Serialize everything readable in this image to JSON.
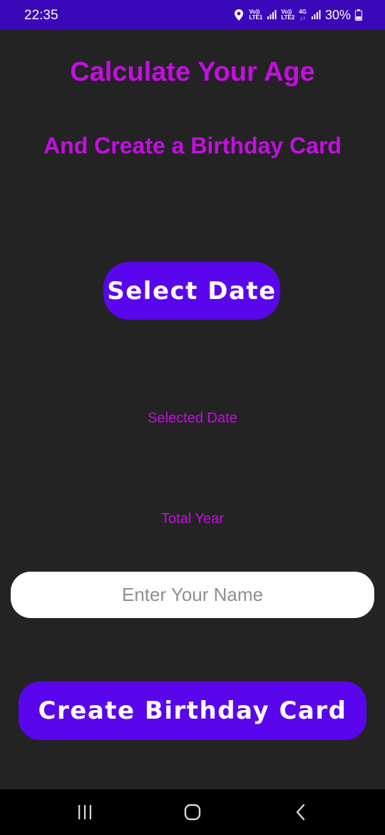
{
  "status_bar": {
    "time": "22:35",
    "sim1_top": "Vo))",
    "sim1_bottom": "LTE1",
    "sim2_top": "Vo))",
    "sim2_bottom": "LTE2",
    "net_type": "4G",
    "battery": "30%"
  },
  "main": {
    "title": "Calculate Your Age",
    "subtitle": "And Create a Birthday Card",
    "select_date_label": "Select Date",
    "selected_date_text": "Selected Date",
    "total_year_text": "Total Year",
    "name_input": {
      "placeholder": "Enter Your Name",
      "value": ""
    },
    "create_card_label": "Create Birthday Card"
  },
  "nav": {
    "icons": [
      "recent-apps-icon",
      "home-icon",
      "back-icon"
    ]
  },
  "colors": {
    "background": "#232323",
    "status_bar": "#3a08b8",
    "accent_text": "#c40ee2",
    "button": "#5a06ec",
    "nav_bar": "#000000"
  }
}
